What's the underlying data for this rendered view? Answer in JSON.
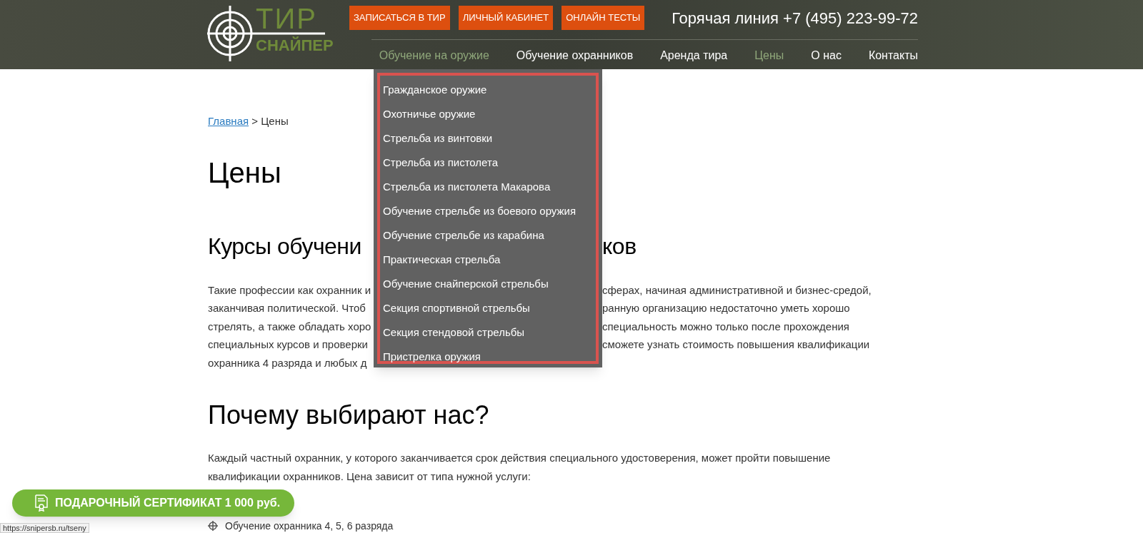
{
  "header": {
    "logo": {
      "line_1": "ТИР",
      "line_2": "СНАЙПЕР"
    },
    "buttons": [
      "ЗАПИСАТЬСЯ В ТИР",
      "ЛИЧНЫЙ КАБИНЕТ",
      "ОНЛАЙН ТЕСТЫ"
    ],
    "hotline": "Горячая линия +7 (495) 223-99-72",
    "nav": [
      {
        "label": "Обучение на оружие",
        "selected": true
      },
      {
        "label": "Обучение охранников",
        "selected": false
      },
      {
        "label": "Аренда тира",
        "selected": false
      },
      {
        "label": "Цены",
        "selected": true
      },
      {
        "label": "О нас",
        "selected": false
      },
      {
        "label": "Контакты",
        "selected": false
      }
    ]
  },
  "dropdown": [
    "Гражданское оружие",
    "Охотничье оружие",
    "Стрельба из винтовки",
    "Стрельба из пистолета",
    "Стрельба из пистолета Макарова",
    "Обучение стрельбе из боевого оружия",
    "Обучение стрельбе из карабина",
    "Практическая стрельба",
    "Обучение снайперской стрельбы",
    "Секция спортивной стрельбы",
    "Секция стендовой стрельбы",
    "Пристрелка оружия"
  ],
  "breadcrumb": {
    "link": "Главная",
    "current": "> Цены"
  },
  "title": "Цены",
  "section_1": {
    "heading": {
      "left": "Курсы обучени",
      "right": "ков"
    },
    "paragraph_lines": [
      {
        "left": "Такие профессии как охранник и",
        "right": "сферах, начиная административной и бизнес-средой,"
      },
      {
        "left": "заканчивая политической. Чтоб",
        "right": "ранную организацию недостаточно уметь хорошо"
      },
      {
        "left": "стрелять, а также обладать хоро",
        "right": "специальность можно только после прохождения"
      },
      {
        "left": "специальных курсов и проверки",
        "right": "сможете узнать стоимость повышения квалификации"
      },
      {
        "left": "охранника 4 разряда и любых д"
      }
    ]
  },
  "section_2": {
    "heading": "Почему выбирают нас?",
    "paragraph": "Каждый частный охранник, у которого заканчивается срок действия специального удостоверения, может пройти повышение квалификации охранников. Цена зависит от типа нужной услуги:",
    "list": [
      "Обучение охранника 4, 5, 6 разряда"
    ]
  },
  "certificate_button": "ПОДАРОЧНЫЙ СЕРТИФИКАТ 1 000 руб.",
  "status_url": "https://snipersb.ru/tseny"
}
